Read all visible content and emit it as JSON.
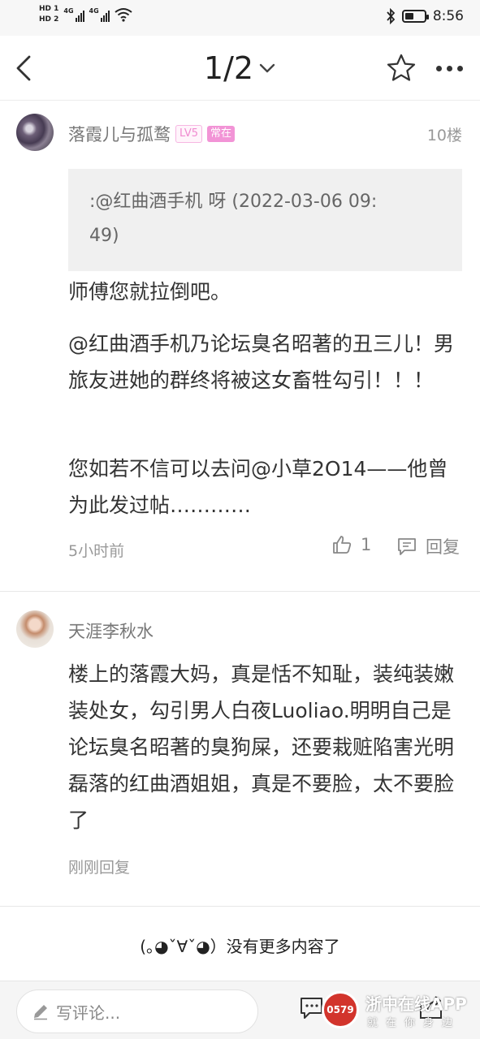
{
  "status_bar": {
    "hd1": "HD 1",
    "hd2": "HD 2",
    "net1": "4G",
    "net2": "4G",
    "time": "8:56",
    "battery_level": 0.45
  },
  "nav": {
    "page_indicator": "1/2"
  },
  "posts": [
    {
      "username": "落霞儿与孤鹜",
      "level_badge": "LV5",
      "status_badge": "常在",
      "floor": "10楼",
      "quote_line1": ":@红曲酒手机     呀 (2022-03-06 09:",
      "quote_line2": "49)",
      "paragraphs": [
        "师傅您就拉倒吧。",
        "@红曲酒手机乃论坛臭名昭著的丑三儿！男旅友进她的群终将被这女畜牲勾引！！！",
        "您如若不信可以去问@小草2O14——他曾为此发过帖…………"
      ],
      "time": "5小时前",
      "like_count": "1",
      "reply_label": "回复"
    },
    {
      "username": "天涯李秋水",
      "body": "楼上的落霞大妈，真是恬不知耻，装纯装嫩装处女，勾引男人白夜Luoliao.明明自己是论坛臭名昭著的臭狗屎，还要栽赃陷害光明磊落的红曲酒姐姐，真是不要脸，太不要脸了",
      "meta": "刚刚回复"
    }
  ],
  "no_more_text": "(｡◕ˇ∀ˇ◕）没有更多内容了",
  "comment_placeholder": "写评论...",
  "watermark": {
    "logo_text": "0579",
    "title": "浙中在线APP",
    "subtitle": "就在你身边"
  },
  "colors": {
    "badge_pink": "#f294d6",
    "background": "#ffffff",
    "bottom_bar": "#f5f5f5"
  }
}
